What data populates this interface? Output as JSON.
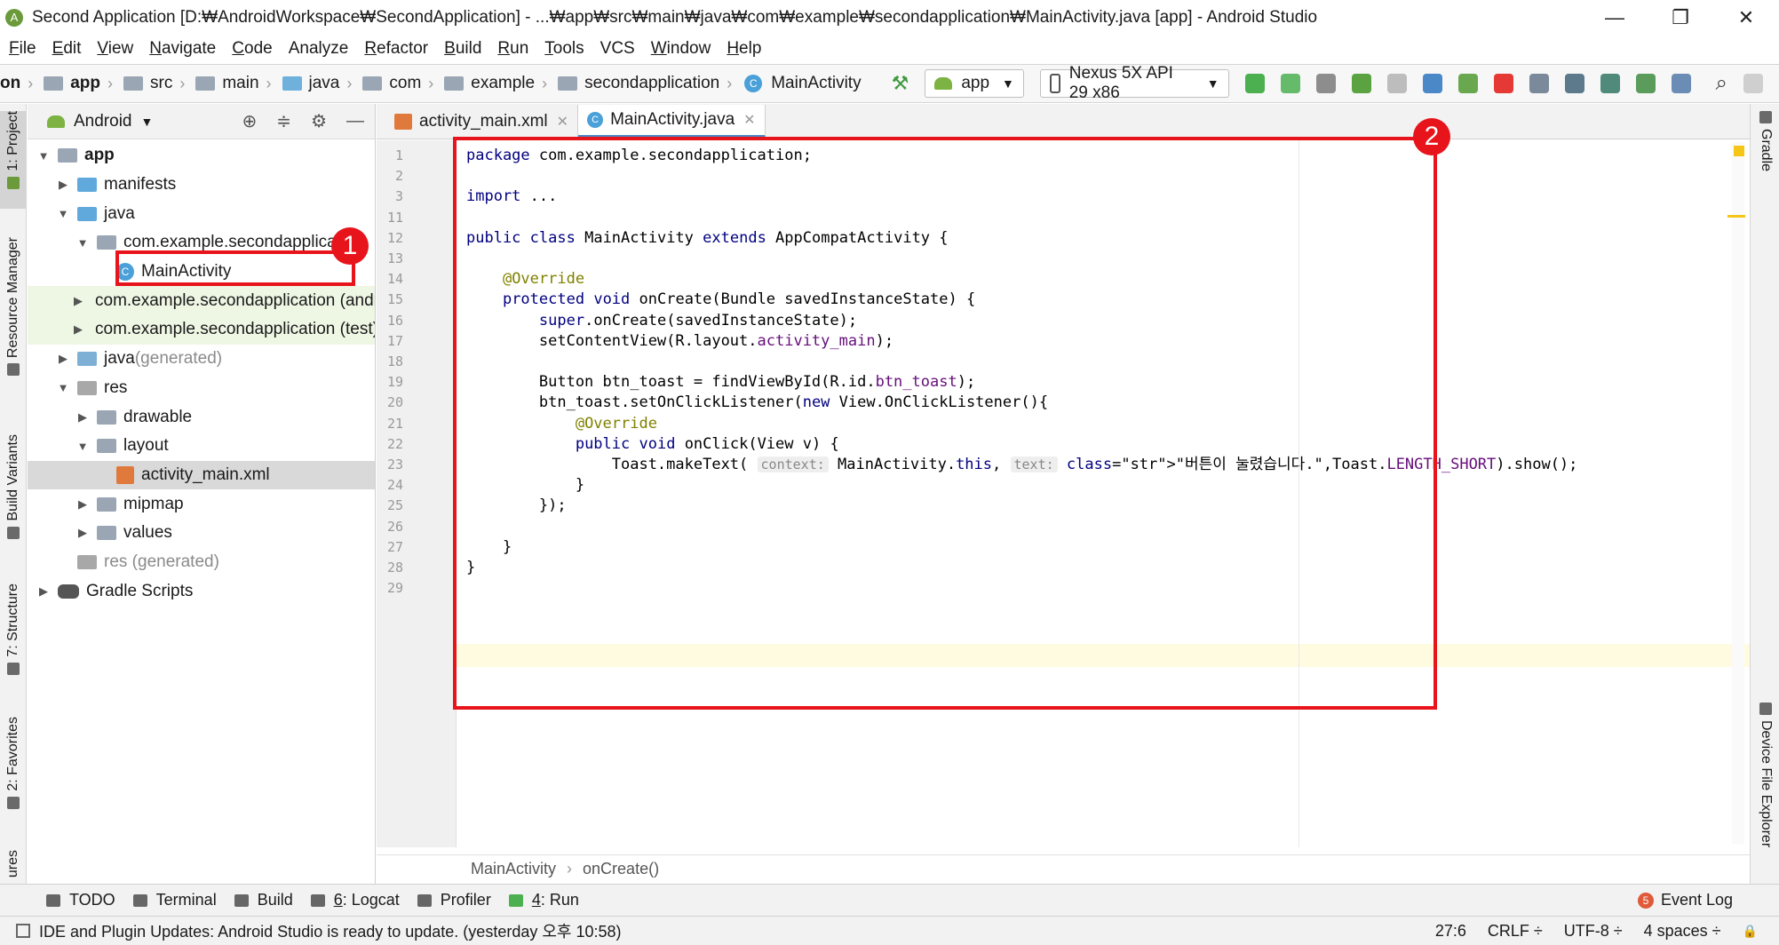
{
  "window": {
    "title": "Second Application [D:₩AndroidWorkspace₩SecondApplication] - ...₩app₩src₩main₩java₩com₩example₩secondapplication₩MainActivity.java [app] - Android Studio",
    "minimize": "—",
    "restore": "❐",
    "close": "✕"
  },
  "menu": [
    {
      "u": "F",
      "rest": "ile"
    },
    {
      "u": "E",
      "rest": "dit"
    },
    {
      "u": "V",
      "rest": "iew"
    },
    {
      "u": "N",
      "rest": "avigate"
    },
    {
      "u": "C",
      "rest": "ode"
    },
    {
      "u": "",
      "rest": "Analyze"
    },
    {
      "u": "R",
      "rest": "efactor"
    },
    {
      "u": "B",
      "rest": "uild"
    },
    {
      "u": "R",
      "rest": "un"
    },
    {
      "u": "T",
      "rest": "ools"
    },
    {
      "u": "",
      "rest": "VCS"
    },
    {
      "u": "W",
      "rest": "indow"
    },
    {
      "u": "H",
      "rest": "elp"
    }
  ],
  "breadcrumbs": [
    "on",
    "app",
    "src",
    "main",
    "java",
    "com",
    "example",
    "secondapplication",
    "MainActivity"
  ],
  "toolbar": {
    "run_config": "app",
    "device": "Nexus 5X API 29 x86",
    "dropdown_arrow": "▼",
    "hammer": "⚒",
    "search": "⌕"
  },
  "left_stripe": {
    "project": "1: Project",
    "resource_manager": "Resource Manager",
    "build_variants": "Build Variants",
    "structure": "7: Structure",
    "favorites": "2: Favorites",
    "captures": "ures"
  },
  "right_stripe": {
    "gradle": "Gradle",
    "device_file_explorer": "Device File Explorer"
  },
  "project_panel": {
    "title": "Android",
    "dropdown": "▼",
    "icons": {
      "locate": "⊕",
      "collapse": "≑",
      "settings": "⚙",
      "hide": "—"
    },
    "tree": [
      {
        "label": "app",
        "tri": "▼",
        "indent": 0,
        "icon": "folder",
        "bold": true
      },
      {
        "label": "manifests",
        "tri": "▶",
        "indent": 1,
        "icon": "folder-blue"
      },
      {
        "label": "java",
        "tri": "▼",
        "indent": 1,
        "icon": "folder-blue"
      },
      {
        "label": "com.example.secondapplication",
        "tri": "▼",
        "indent": 2,
        "icon": "folder"
      },
      {
        "label": "MainActivity",
        "tri": "",
        "indent": 3,
        "icon": "class"
      },
      {
        "label": "com.example.secondapplication (androidTest)",
        "tri": "▶",
        "indent": 2,
        "icon": "folder",
        "green": true
      },
      {
        "label": "com.example.secondapplication (test)",
        "tri": "▶",
        "indent": 2,
        "icon": "folder",
        "green": true
      },
      {
        "label": "java",
        "suffix": " (generated)",
        "tri": "▶",
        "indent": 1,
        "icon": "folder-gen"
      },
      {
        "label": "res",
        "tri": "▼",
        "indent": 1,
        "icon": "folder-res"
      },
      {
        "label": "drawable",
        "tri": "▶",
        "indent": 2,
        "icon": "folder"
      },
      {
        "label": "layout",
        "tri": "▼",
        "indent": 2,
        "icon": "folder"
      },
      {
        "label": "activity_main.xml",
        "tri": "",
        "indent": 3,
        "icon": "xml",
        "selected": true
      },
      {
        "label": "mipmap",
        "tri": "▶",
        "indent": 2,
        "icon": "folder"
      },
      {
        "label": "values",
        "tri": "▶",
        "indent": 2,
        "icon": "folder"
      },
      {
        "label": "res (generated)",
        "tri": "",
        "indent": 1,
        "icon": "folder-res",
        "gray": true
      },
      {
        "label": "Gradle Scripts",
        "tri": "▶",
        "indent": 0,
        "icon": "gradle"
      }
    ]
  },
  "editor": {
    "tabs": [
      {
        "label": "activity_main.xml",
        "close": "✕",
        "type": "xml"
      },
      {
        "label": "MainActivity.java",
        "close": "✕",
        "type": "class",
        "active": true
      }
    ],
    "line_numbers": [
      "1",
      "2",
      "3",
      "11",
      "12",
      "13",
      "14",
      "15",
      "16",
      "17",
      "18",
      "19",
      "20",
      "21",
      "22",
      "23",
      "24",
      "25",
      "26",
      "27",
      "28",
      "29"
    ],
    "code_lines": [
      "package com.example.secondapplication;",
      "",
      "import ...",
      "",
      "public class MainActivity extends AppCompatActivity {",
      "",
      "    @Override",
      "    protected void onCreate(Bundle savedInstanceState) {",
      "        super.onCreate(savedInstanceState);",
      "        setContentView(R.layout.activity_main);",
      "",
      "        Button btn_toast = findViewById(R.id.btn_toast);",
      "        btn_toast.setOnClickListener(new View.OnClickListener(){",
      "            @Override",
      "            public void onClick(View v) {",
      "                Toast.makeText( context: MainActivity.this, text: \"버튼이 눌렸습니다.\",Toast.LENGTH_SHORT).show();",
      "            }",
      "        });",
      "",
      "    }",
      "}",
      ""
    ],
    "breadcrumb": [
      "MainActivity",
      "onCreate()"
    ],
    "breadcrumb_sep": "›"
  },
  "annotations": [
    {
      "number": "1"
    },
    {
      "number": "2"
    }
  ],
  "bottom_tools": [
    {
      "label": "TODO"
    },
    {
      "label": "Terminal"
    },
    {
      "label": "Build"
    },
    {
      "prefix": "6",
      "label": ": Logcat"
    },
    {
      "label": "Profiler"
    },
    {
      "prefix": "4",
      "label": ": Run"
    }
  ],
  "event_log": {
    "count": "5",
    "label": "Event Log"
  },
  "status": {
    "message": "IDE and Plugin Updates: Android Studio is ready to update. (yesterday 오후 10:58)",
    "position": "27:6",
    "line_sep": "CRLF ÷",
    "encoding": "UTF-8 ÷",
    "indent": "4 spaces ÷",
    "lock": "🔒"
  }
}
